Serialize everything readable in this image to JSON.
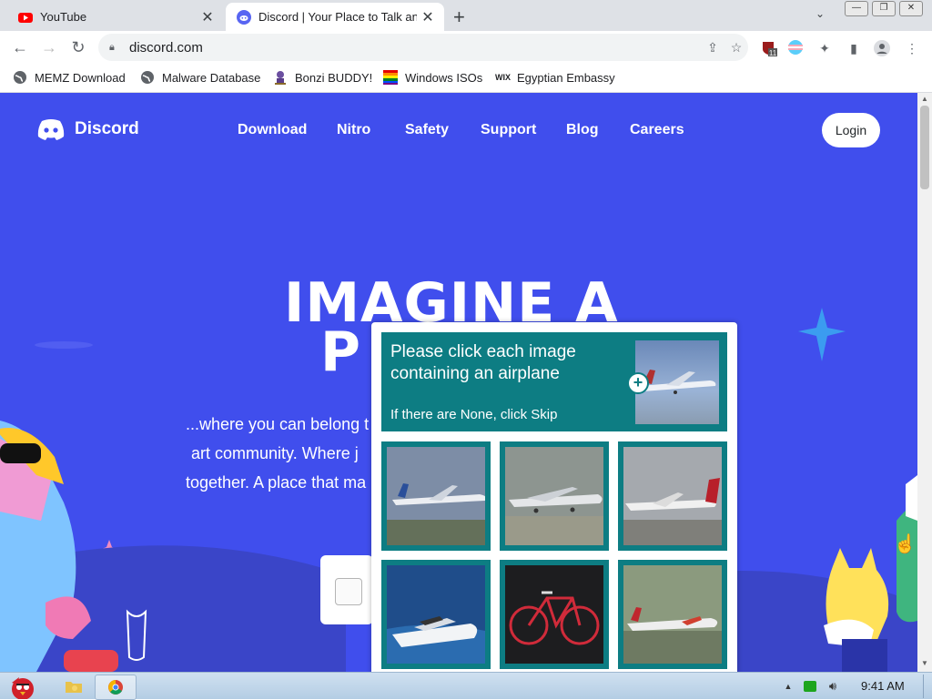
{
  "browser": {
    "tabs": [
      {
        "title": "YouTube",
        "icon": "youtube-icon",
        "active": false
      },
      {
        "title": "Discord | Your Place to Talk and Hang Out",
        "icon": "discord-icon",
        "active": true
      }
    ],
    "url": "discord.com",
    "extension_badge": "11",
    "bookmarks": [
      {
        "label": "MEMZ Download",
        "icon": "globe-icon"
      },
      {
        "label": "Malware Database",
        "icon": "globe-icon"
      },
      {
        "label": "Bonzi BUDDY!",
        "icon": "bonzi-icon"
      },
      {
        "label": "Windows ISOs",
        "icon": "windows-icon"
      },
      {
        "label": "Egyptian Embassy",
        "icon": "wix-icon"
      }
    ]
  },
  "page": {
    "logo_text": "Discord",
    "nav": [
      "Download",
      "Nitro",
      "Safety",
      "Support",
      "Blog",
      "Careers"
    ],
    "login_label": "Login",
    "hero_line1": "IMAGINE A",
    "hero_line2_visible": "P",
    "subtitle_lines": [
      "...where you can belong t",
      "art community. Where j",
      "together. A place that ma"
    ],
    "background_color": "#404eed"
  },
  "captcha": {
    "prompt": "Please click each image containing an airplane",
    "skip_hint": "If there are None, click Skip",
    "accent_color": "#0d7d83",
    "tiles": [
      {
        "depicts": "airplane"
      },
      {
        "depicts": "airplane"
      },
      {
        "depicts": "airplane"
      },
      {
        "depicts": "boat"
      },
      {
        "depicts": "bicycle"
      },
      {
        "depicts": "airplane"
      }
    ]
  },
  "taskbar": {
    "clock": "9:41 AM",
    "items": [
      "start-bird-icon",
      "folder-icon",
      "chrome-icon"
    ]
  }
}
